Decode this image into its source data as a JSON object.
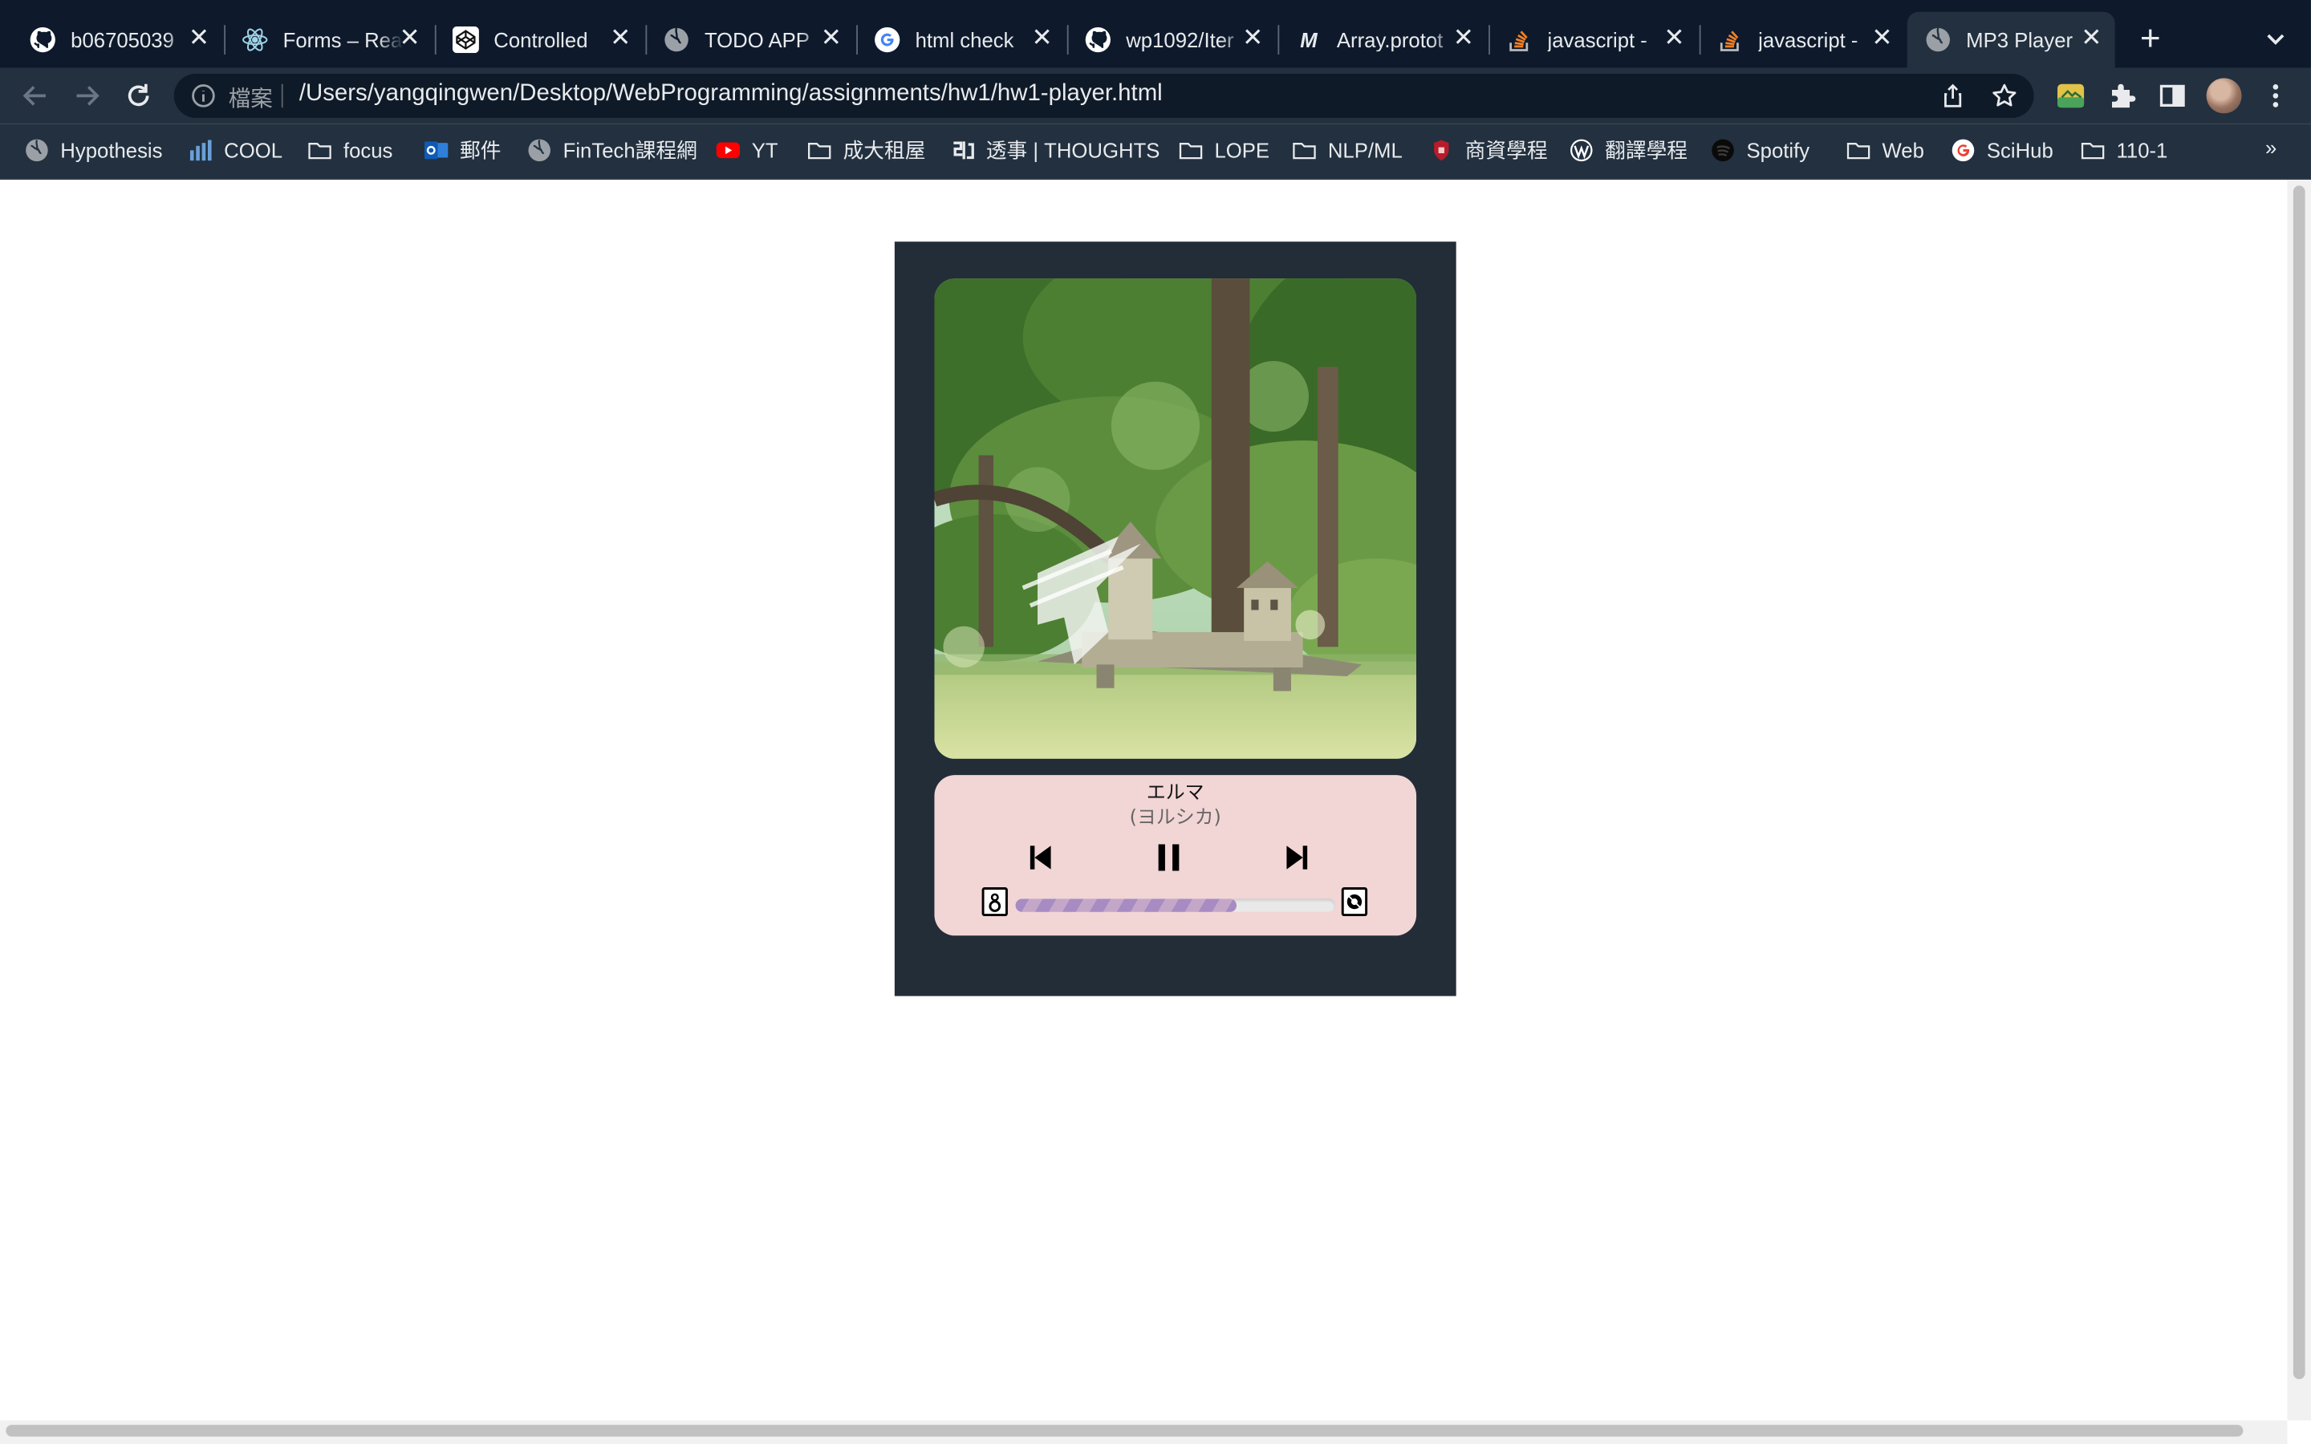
{
  "browser": {
    "tabs": [
      {
        "title": "b06705039",
        "icon": "github-icon"
      },
      {
        "title": "Forms – React",
        "icon": "react-icon"
      },
      {
        "title": "Controlled",
        "icon": "codepen-icon"
      },
      {
        "title": "TODO APP",
        "icon": "globe-icon"
      },
      {
        "title": "html check",
        "icon": "google-icon"
      },
      {
        "title": "wp1092/Iter",
        "icon": "github-icon"
      },
      {
        "title": "Array.protot",
        "icon": "mdn-icon"
      },
      {
        "title": "javascript -",
        "icon": "stackoverflow-icon"
      },
      {
        "title": "javascript -",
        "icon": "stackoverflow-icon"
      },
      {
        "title": "MP3 Player",
        "icon": "globe-icon",
        "active": true
      }
    ],
    "omnibox": {
      "scheme_label": "檔案",
      "url": "/Users/yangqingwen/Desktop/WebProgramming/assignments/hw1/hw1-player.html"
    },
    "bookmarks": [
      {
        "label": "Hypothesis",
        "icon": "globe-icon"
      },
      {
        "label": "COOL",
        "icon": "cool-icon"
      },
      {
        "label": "focus",
        "icon": "folder-icon"
      },
      {
        "label": "郵件",
        "icon": "outlook-icon"
      },
      {
        "label": "FinTech課程網",
        "icon": "globe-icon"
      },
      {
        "label": "YT",
        "icon": "youtube-icon"
      },
      {
        "label": "成大租屋",
        "icon": "folder-icon"
      },
      {
        "label": "透事 | THOUGHTS",
        "icon": "thoughts-icon"
      },
      {
        "label": "LOPE",
        "icon": "folder-icon"
      },
      {
        "label": "NLP/ML",
        "icon": "folder-icon"
      },
      {
        "label": "商資學程",
        "icon": "shield-icon"
      },
      {
        "label": "翻譯學程",
        "icon": "wordpress-icon"
      },
      {
        "label": "Spotify",
        "icon": "spotify-icon"
      },
      {
        "label": "Web",
        "icon": "folder-icon"
      },
      {
        "label": "SciHub",
        "icon": "google-icon"
      },
      {
        "label": "110-1",
        "icon": "folder-icon"
      }
    ],
    "bookmarks_overflow": "»"
  },
  "player": {
    "song_title": "エルマ",
    "artist": "(ヨルシカ)",
    "state": "playing",
    "progress": 0.69,
    "colors": {
      "card_bg": "#232d38",
      "panel_bg": "#f2d5d5",
      "progress_fill": "#a78bc2"
    }
  }
}
